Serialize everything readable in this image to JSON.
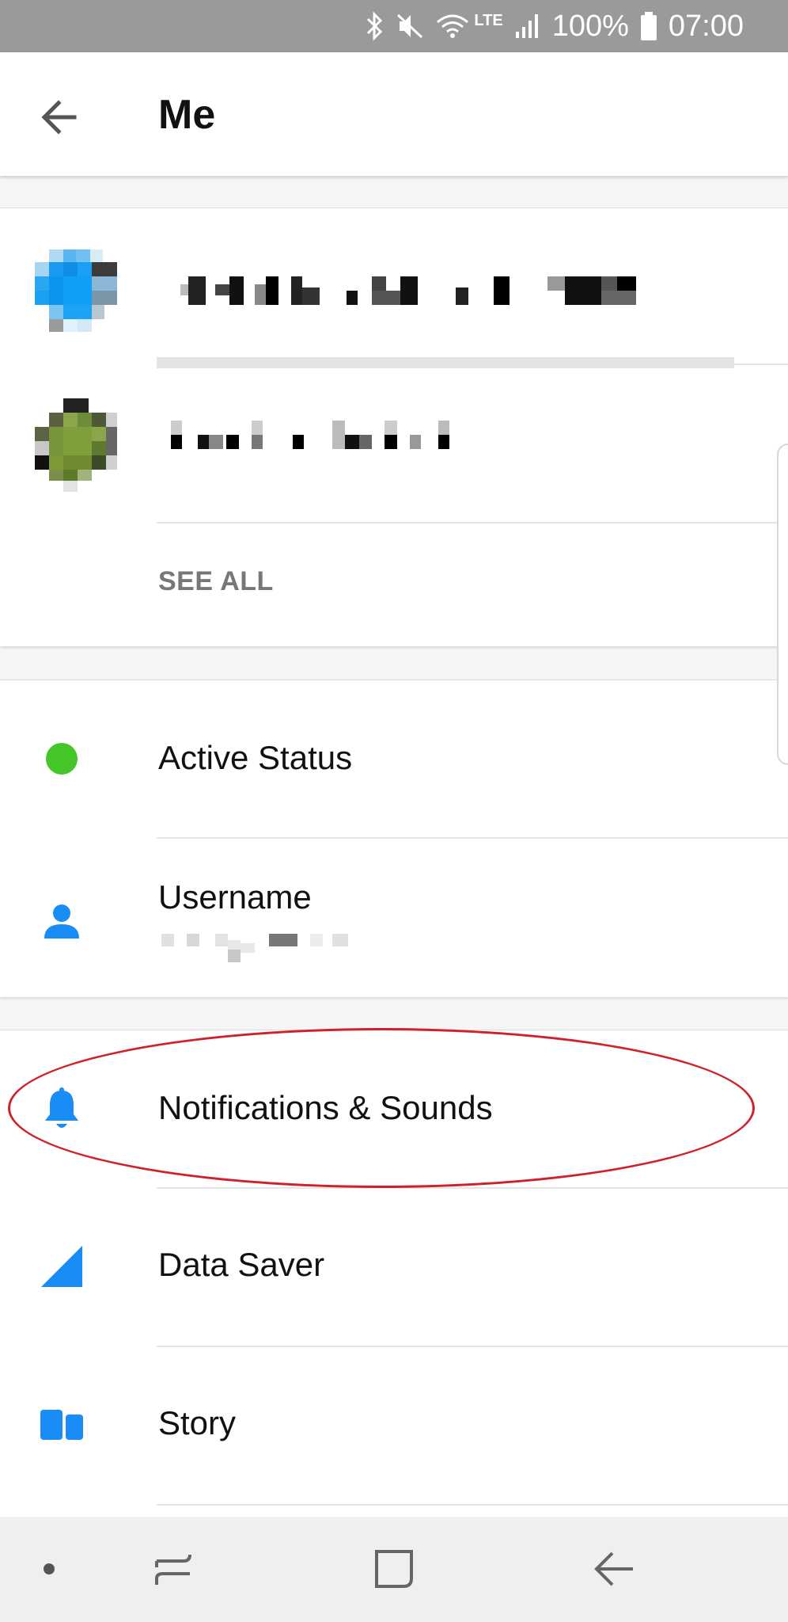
{
  "status_bar": {
    "battery": "100%",
    "time": "07:00",
    "network": "LTE",
    "icons": [
      "bluetooth-icon",
      "mute-icon",
      "wifi-icon",
      "signal-icon",
      "battery-icon"
    ]
  },
  "header": {
    "title": "Me",
    "back_icon": "arrow-back-icon"
  },
  "accounts": {
    "see_all": "SEE ALL"
  },
  "settings_group_1": [
    {
      "label": "Active Status",
      "icon": "green-dot-icon",
      "color": "#44c528"
    },
    {
      "label": "Username",
      "icon": "person-icon",
      "color": "#1a8cf5"
    }
  ],
  "settings_group_2": [
    {
      "label": "Notifications & Sounds",
      "icon": "bell-icon",
      "color": "#1a8cf5"
    },
    {
      "label": "Data Saver",
      "icon": "signal-triangle-icon",
      "color": "#1a8cf5"
    },
    {
      "label": "Story",
      "icon": "story-icon",
      "color": "#1a8cf5"
    }
  ],
  "colors": {
    "accent": "#1a8cf5",
    "active_green": "#44c528",
    "highlight_red": "#d0202a",
    "status_bar": "#9a9a9a"
  },
  "nav_bar": {
    "icons": [
      "dot-icon",
      "recents-icon",
      "home-icon",
      "back-icon"
    ]
  }
}
